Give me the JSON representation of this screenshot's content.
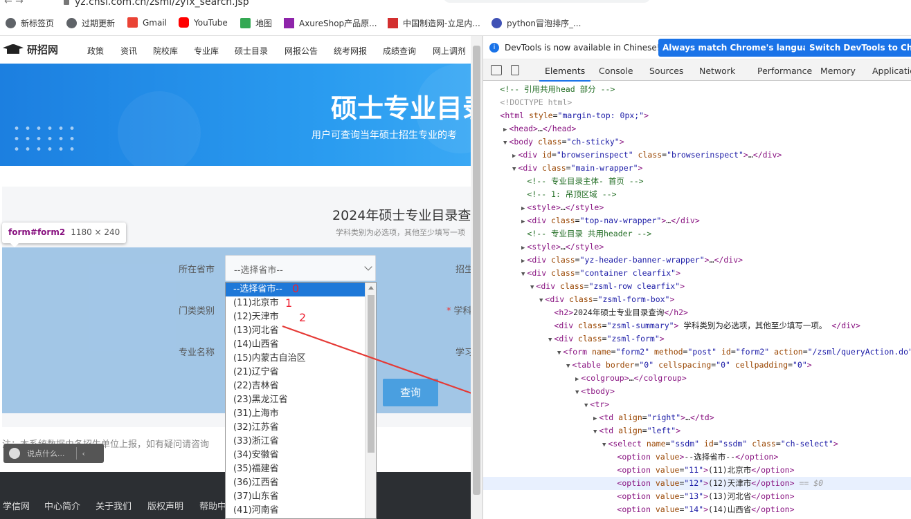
{
  "browser": {
    "url": "yz.chsi.com.cn/zsml/zyfx_search.jsp",
    "bookmarks": [
      "新标签页",
      "过期更新",
      "Gmail",
      "YouTube",
      "地图",
      "AxureShop产品原...",
      "中国制造网-立足内...",
      "python冒泡排序_..."
    ]
  },
  "site": {
    "logo": "研招网",
    "nav": [
      "政策",
      "资讯",
      "院校库",
      "专业库",
      "硕士目录",
      "网报公告",
      "统考网报",
      "成绩查询",
      "网上调剂"
    ],
    "banner_title": "硕士专业目录",
    "banner_subtitle": "用户可查询当年硕士招生专业的考",
    "form_title": "2024年硕士专业目录查",
    "form_summary": "学科类别为必选项，其他至少填写一项",
    "labels": {
      "province": "所在省市",
      "category": "门类类别",
      "major": "专业名称",
      "recruit": "招生",
      "discipline": "学科",
      "study": "学习"
    },
    "select_placeholder": "--选择省市--",
    "query_button": "查询",
    "note": "注：本系统数据由各招生单位上报，如有疑问请咨询",
    "chat_placeholder": "说点什么...",
    "footer_links": [
      "学信网",
      "中心简介",
      "关于我们",
      "版权声明",
      "帮助中"
    ]
  },
  "inspector_tooltip": {
    "selector": "form#form2",
    "size": "1180 × 240"
  },
  "dropdown": {
    "options": [
      "--选择省市--",
      "(11)北京市",
      "(12)天津市",
      "(13)河北省",
      "(14)山西省",
      "(15)内蒙古自治区",
      "(21)辽宁省",
      "(22)吉林省",
      "(23)黑龙江省",
      "(31)上海市",
      "(32)江苏省",
      "(33)浙江省",
      "(34)安徽省",
      "(35)福建省",
      "(36)江西省",
      "(37)山东省",
      "(41)河南省"
    ],
    "selected_index": 0
  },
  "annotations": {
    "a0": "0",
    "a1": "1",
    "a2": "2",
    "accent": "#e53935"
  },
  "devtools": {
    "info_message": "DevTools is now available in Chinese!",
    "info_btn1": "Always match Chrome's language",
    "info_btn2": "Switch DevTools to Chinese",
    "tabs": [
      "Elements",
      "Console",
      "Sources",
      "Network",
      "Performance",
      "Memory",
      "Application"
    ],
    "active_tab": "Elements",
    "lines": [
      "<!-- 引用共用head 部分 -->",
      "<!DOCTYPE html>",
      "<html style=\"margin-top: 0px;\">",
      "<head>…</head>",
      "<body class=\"ch-sticky\">",
      "<div id=\"browserinspect\" class=\"browserinspect\">…</div>",
      "<div class=\"main-wrapper\">",
      "<!-- 专业目录主体- 首页 -->",
      "<!-- 1: 吊顶区域 -->",
      "<style>…</style>",
      "<div class=\"top-nav-wrapper\">…</div>",
      "<!-- 专业目录 共用header -->",
      "<style>…</style>",
      "<div class=\"yz-header-banner-wrapper\">…</div>",
      "<div class=\"container clearfix\">",
      "<div class=\"zsml-row clearfix\">",
      "<div class=\"zsml-form-box\">",
      "<h2>2024年硕士专业目录查询</h2>",
      "<div class=\"zsml-summary\"> 学科类别为必选项，其他至少填写一项。 </div>",
      "<div class=\"zsml-form\">",
      "<form name=\"form2\" method=\"post\" id=\"form2\" action=\"/zsml/queryAction.do\">",
      "<table border=\"0\" cellspacing=\"0\" cellpadding=\"0\">",
      "<colgroup>…</colgroup>",
      "<tbody>",
      "<tr>",
      "<td align=\"right\">…</td>",
      "<td align=\"left\">",
      "<select name=\"ssdm\" id=\"ssdm\" class=\"ch-select\">",
      "<option value>--选择省市--</option>",
      "<option value=\"11\">(11)北京市</option>",
      "<option value=\"12\">(12)天津市</option> == $0",
      "<option value=\"13\">(13)河北省</option>",
      "<option value=\"14\">(14)山西省</option>"
    ]
  }
}
